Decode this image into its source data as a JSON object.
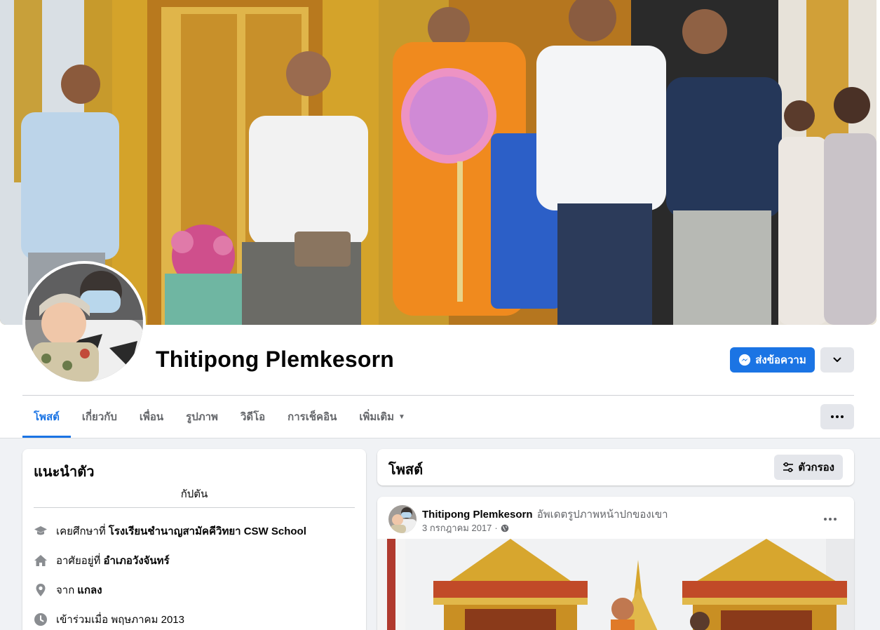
{
  "profile": {
    "name": "Thitipong Plemkesorn",
    "message_button": "ส่งข้อความ"
  },
  "tabs": [
    {
      "label": "โพสต์",
      "active": true
    },
    {
      "label": "เกี่ยวกับ"
    },
    {
      "label": "เพื่อน"
    },
    {
      "label": "รูปภาพ"
    },
    {
      "label": "วิดีโอ"
    },
    {
      "label": "การเช็คอิน"
    },
    {
      "label": "เพิ่มเติม",
      "dropdown": true
    }
  ],
  "intro": {
    "title": "แนะนำตัว",
    "quote": "กัปตัน",
    "items": [
      {
        "icon": "graduation-cap-icon",
        "prefix": "เคยศึกษาที่",
        "value": "โรงเรียนชำนาญสามัคคีวิทยา CSW School"
      },
      {
        "icon": "home-icon",
        "prefix": "อาศัยอยู่ที่",
        "value": "อำเภอวังจันทร์"
      },
      {
        "icon": "location-pin-icon",
        "prefix": "จาก",
        "value": "แกลง"
      },
      {
        "icon": "clock-icon",
        "prefix": "เข้าร่วมเมื่อ พฤษภาคม 2013",
        "value": ""
      }
    ]
  },
  "posts_section": {
    "title": "โพสต์",
    "filter_button": "ตัวกรอง"
  },
  "post": {
    "author": "Thitipong Plemkesorn",
    "action": "อัพเดตรูปภาพหน้าปกของเขา",
    "date": "3 กรกฎาคม 2017",
    "privacy_icon": "globe-icon"
  },
  "colors": {
    "accent": "#1b74e4",
    "button_gray": "#e4e6eb",
    "background": "#f0f2f5",
    "secondary_text": "#65676b"
  }
}
